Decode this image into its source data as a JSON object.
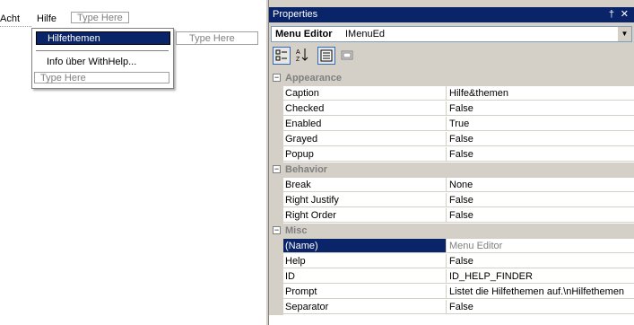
{
  "designer": {
    "menubar": [
      "Acht",
      "Hilfe"
    ],
    "type_here": "Type Here",
    "submenu": {
      "selected_item": "Hilfethemen",
      "info_item": "Info über WithHelp...",
      "type_here_side": "Type Here",
      "type_here_bottom": "Type Here"
    }
  },
  "properties": {
    "title": "Properties",
    "pin_glyph": "†",
    "close_glyph": "✕",
    "object_name": "Menu Editor",
    "object_class": "IMenuEd",
    "toolbar": [
      "categorized-icon",
      "alphabetical-icon",
      "properties-icon",
      "property-pages-icon"
    ],
    "categories": [
      {
        "name": "Appearance",
        "props": [
          {
            "name": "Caption",
            "value": "Hilfe&themen"
          },
          {
            "name": "Checked",
            "value": "False"
          },
          {
            "name": "Enabled",
            "value": "True"
          },
          {
            "name": "Grayed",
            "value": "False"
          },
          {
            "name": "Popup",
            "value": "False"
          }
        ]
      },
      {
        "name": "Behavior",
        "props": [
          {
            "name": "Break",
            "value": "None"
          },
          {
            "name": "Right Justify",
            "value": "False"
          },
          {
            "name": "Right Order",
            "value": "False"
          }
        ]
      },
      {
        "name": "Misc",
        "props": [
          {
            "name": "(Name)",
            "value": "Menu Editor"
          },
          {
            "name": "Help",
            "value": "False"
          },
          {
            "name": "ID",
            "value": "ID_HELP_FINDER"
          },
          {
            "name": "Prompt",
            "value": "Listet die Hilfethemen auf.\\nHilfethemen"
          },
          {
            "name": "Separator",
            "value": "False"
          }
        ]
      }
    ]
  }
}
